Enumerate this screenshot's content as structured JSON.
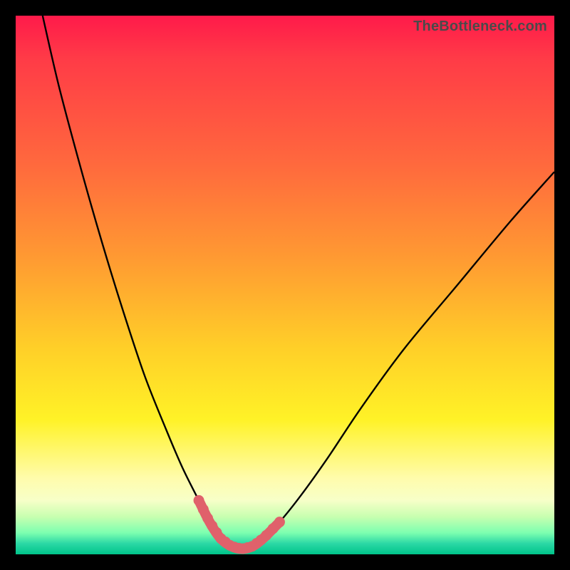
{
  "brand": "TheBottleneck.com",
  "colors": {
    "frame": "#000000",
    "gradient_top": "#ff1a4a",
    "gradient_mid": "#fff227",
    "gradient_bottom": "#00c48a",
    "highlight_stroke": "#e0616b",
    "curve_stroke": "#000000"
  },
  "chart_data": {
    "type": "line",
    "title": "",
    "xlabel": "",
    "ylabel": "",
    "xlim": [
      0,
      100
    ],
    "ylim": [
      0,
      100
    ],
    "grid": false,
    "series": [
      {
        "name": "bottleneck-curve",
        "x": [
          5,
          8,
          12,
          16,
          20,
          24,
          28,
          31,
          34,
          36,
          38,
          40,
          42,
          44,
          46,
          49,
          53,
          58,
          64,
          72,
          82,
          92,
          100
        ],
        "y": [
          100,
          87,
          72,
          58,
          45,
          33,
          23,
          16,
          10,
          6,
          3,
          1.5,
          1,
          1.5,
          3,
          6,
          11,
          18,
          27,
          38,
          50,
          62,
          71
        ]
      },
      {
        "name": "sweet-spot-highlight",
        "x": [
          34,
          36,
          38,
          40,
          42,
          44,
          46,
          49
        ],
        "y": [
          10,
          6,
          3,
          1.5,
          1,
          1.5,
          3,
          6
        ]
      }
    ]
  }
}
